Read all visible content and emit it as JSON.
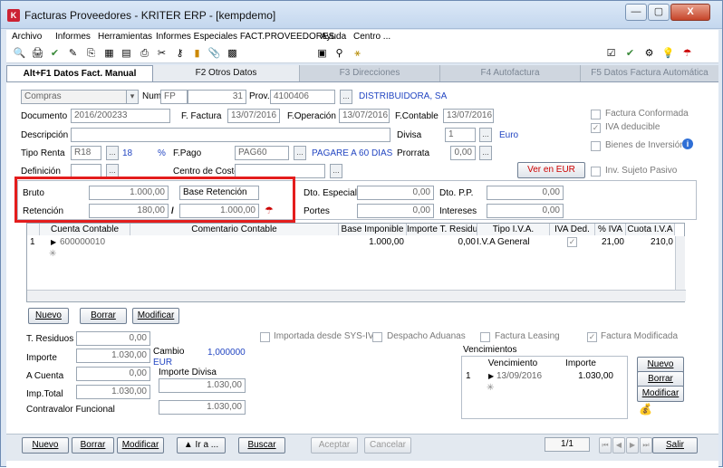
{
  "window": {
    "title": "Facturas Proveedores  -  KRITER ERP  -  [kempdemo]",
    "minimize": "—",
    "maximize": "▢",
    "close": "X"
  },
  "menu": [
    "Archivo",
    "Informes",
    "Herramientas",
    "Informes Especiales FACT.PROVEEDORES",
    "Ayuda",
    "Centro ..."
  ],
  "tabs": [
    "Alt+F1 Datos Fact. Manual",
    "F2 Otros Datos",
    "F3 Direcciones",
    "F4 Autofactura",
    "F5 Datos Factura Automática"
  ],
  "form": {
    "tipo": "Compras",
    "num_label": "Num.",
    "num_prefix": "FP",
    "num_value": "31",
    "prov_label": "Prov.",
    "prov_code": "4100406",
    "prov_name": "DISTRIBUIDORA, SA",
    "documento_label": "Documento",
    "documento": "2016/200233",
    "ffactura_label": "F. Factura",
    "ffactura": "13/07/2016",
    "foperacion_label": "F.Operación",
    "foperacion": "13/07/2016",
    "fcontable_label": "F.Contable",
    "fcontable": "13/07/2016",
    "descripcion_label": "Descripción",
    "divisa_label": "Divisa",
    "divisa": "1",
    "divisa_name": "Euro",
    "tiporenta_label": "Tipo Renta",
    "tiporenta": "R18",
    "tiporenta_val": "18",
    "percent": "%",
    "fpago_label": "F.Pago",
    "fpago": "PAG60",
    "fpago_name": "PAGARE A 60 DIAS",
    "prorrata_label": "Prorrata",
    "prorrata": "0,00",
    "definicion_label": "Definición",
    "centro_label": "Centro de Coste",
    "ver_eur": "Ver en EUR",
    "factura_conformada": "Factura Conformada",
    "iva_deducible": "IVA deducible",
    "bienes_inversion": "Bienes de Inversión",
    "inv_sujeto": "Inv. Sujeto Pasivo",
    "bruto_label": "Bruto",
    "bruto": "1.000,00",
    "base_ret_label": "Base Retención",
    "retencion_label": "Retención",
    "retencion": "180,00",
    "slash": "/",
    "base_ret": "1.000,00",
    "dto_esp_label": "Dto. Especial",
    "dto_esp": "0,00",
    "dto_pp_label": "Dto. P.P.",
    "dto_pp": "0,00",
    "portes_label": "Portes",
    "portes": "0,00",
    "intereses_label": "Intereses",
    "intereses": "0,00"
  },
  "grid": {
    "headers": [
      "Cuenta Contable",
      "Comentario Contable",
      "Base Imponible",
      "Importe T. Residuos",
      "Tipo I.V.A.",
      "IVA Ded.",
      "% IVA",
      "Cuota I.V.A"
    ],
    "row": {
      "num": "1",
      "cuenta": "600000010",
      "base": "1.000,00",
      "residuos": "0,00",
      "tipo": "I.V.A General",
      "pct": "21,00",
      "cuota": "210,0"
    }
  },
  "grid_buttons": {
    "nuevo": "Nuevo",
    "borrar": "Borrar",
    "modificar": "Modificar"
  },
  "totals": {
    "residuos_label": "T. Residuos",
    "residuos": "0,00",
    "importe_label": "Importe",
    "importe": "1.030,00",
    "cambio_label": "Cambio",
    "cambio": "1,000000",
    "cambio_cur": "EUR",
    "acuenta_label": "A Cuenta",
    "acuenta": "0,00",
    "importe_divisa_label": "Importe Divisa",
    "importe_divisa": "1.030,00",
    "imptotal_label": "Imp.Total",
    "imptotal": "1.030,00",
    "contravalor_label": "Contravalor Funcional",
    "contravalor": "1.030,00"
  },
  "flags": {
    "importada": "Importada desde SYS-IV",
    "despacho": "Despacho Aduanas",
    "leasing": "Factura Leasing",
    "modificada": "Factura Modificada"
  },
  "vencimientos": {
    "title": "Vencimientos",
    "col_venc": "Vencimiento",
    "col_importe": "Importe",
    "row_num": "1",
    "fecha": "13/09/2016",
    "importe": "1.030,00",
    "nuevo": "Nuevo",
    "borrar": "Borrar",
    "modificar": "Modificar"
  },
  "bottom": {
    "nuevo": "Nuevo",
    "borrar": "Borrar",
    "modificar": "Modificar",
    "ira": "▲ Ir a ...",
    "buscar": "Buscar",
    "aceptar": "Aceptar",
    "cancelar": "Cancelar",
    "page": "1/1",
    "salir": "Salir"
  }
}
